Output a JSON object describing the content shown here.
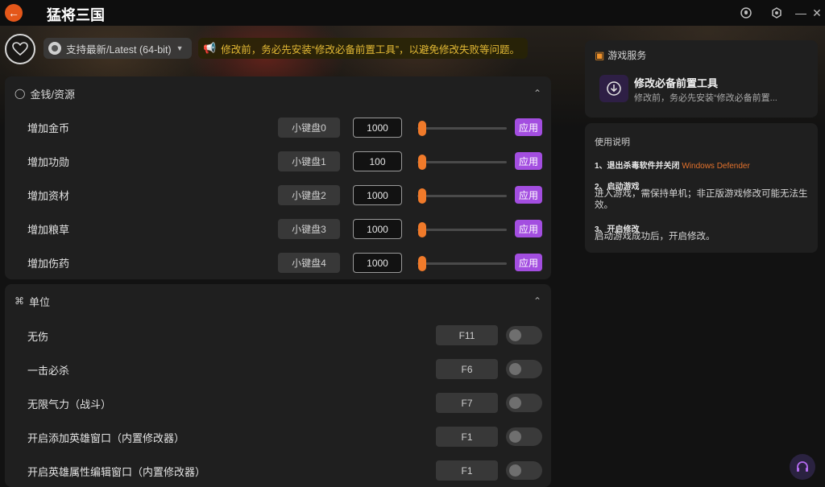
{
  "app": {
    "title": "猛将三国"
  },
  "toolbar": {
    "version_label": "支持最新/Latest (64-bit)",
    "notice": "修改前，务必先安装“修改必备前置工具”，以避免修改失败等问题。"
  },
  "resources": {
    "title": "金钱/资源",
    "apply_label": "应用",
    "rows": [
      {
        "label": "增加金币",
        "hotkey": "小键盘0",
        "value": "1000",
        "slider_level": 0
      },
      {
        "label": "增加功勋",
        "hotkey": "小键盘1",
        "value": "100",
        "slider_level": 0
      },
      {
        "label": "增加资材",
        "hotkey": "小键盘2",
        "value": "1000",
        "slider_level": 0
      },
      {
        "label": "增加粮草",
        "hotkey": "小键盘3",
        "value": "1000",
        "slider_level": 0
      },
      {
        "label": "增加伤药",
        "hotkey": "小键盘4",
        "value": "1000",
        "slider_level": 0
      }
    ]
  },
  "units": {
    "title": "单位",
    "rows": [
      {
        "label": "无伤",
        "hotkey": "F11",
        "enabled": false
      },
      {
        "label": "一击必杀",
        "hotkey": "F6",
        "enabled": false
      },
      {
        "label": "无限气力（战斗）",
        "hotkey": "F7",
        "enabled": false
      },
      {
        "label": "开启添加英雄窗口（内置修改器）",
        "hotkey": "F1",
        "enabled": false
      },
      {
        "label": "开启英雄属性编辑窗口（内置修改器）",
        "hotkey": "F1",
        "enabled": false
      }
    ]
  },
  "service": {
    "title": "游戏服务",
    "item_name": "修改必备前置工具",
    "item_desc": "修改前，务必先安装“修改必备前置..."
  },
  "help": {
    "title": "使用说明",
    "step1_title": "1、退出杀毒软件并关闭",
    "step1_link": "Windows Defender",
    "step2_title": "2、启动游戏",
    "step2_text": "进入游戏，需保持单机；非正版游戏修改可能无法生效。",
    "step3_title": "3、开启修改",
    "step3_text": "启动游戏成功后，开启修改。"
  },
  "colors": {
    "accent": "#f07a2a",
    "apply": "#a34ee0",
    "notice": "#e3b935",
    "back_button": "#e4571a"
  }
}
